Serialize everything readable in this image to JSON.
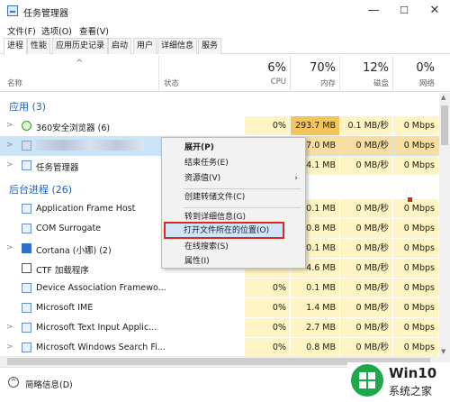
{
  "window": {
    "title": "任务管理器",
    "min": "—",
    "max": "☐",
    "close": "✕"
  },
  "menu": [
    "文件(F)",
    "选项(O)",
    "查看(V)"
  ],
  "tabs": [
    "进程",
    "性能",
    "应用历史记录",
    "启动",
    "用户",
    "详细信息",
    "服务"
  ],
  "columns": {
    "name": "名称",
    "status": "状态",
    "cpu_pct": "6%",
    "cpu": "CPU",
    "mem_pct": "70%",
    "mem": "内存",
    "disk_pct": "12%",
    "disk": "磁盘",
    "net_pct": "0%",
    "net": "网络"
  },
  "groups": {
    "apps": "应用 (3)",
    "background": "后台进程 (26)"
  },
  "rows": [
    {
      "name": "360安全浏览器 (6)",
      "cpu": "0%",
      "mem": "293.7 MB",
      "disk": "0.1 MB/秒",
      "net": "0 Mbps"
    },
    {
      "name": "",
      "cpu": "",
      "mem": "7.0 MB",
      "disk": "0 MB/秒",
      "net": "0 Mbps"
    },
    {
      "name": "任务管理器",
      "cpu": "",
      "mem": "4.1 MB",
      "disk": "0 MB/秒",
      "net": "0 Mbps"
    },
    {
      "name": "Application Frame Host",
      "cpu": "",
      "mem": "0.1 MB",
      "disk": "0 MB/秒",
      "net": "0 Mbps"
    },
    {
      "name": "COM Surrogate",
      "cpu": "",
      "mem": "0.8 MB",
      "disk": "0 MB/秒",
      "net": "0 Mbps"
    },
    {
      "name": "Cortana (小娜) (2)",
      "cpu": "",
      "mem": "0.1 MB",
      "disk": "0 MB/秒",
      "net": "0 Mbps"
    },
    {
      "name": "CTF 加载程序",
      "cpu": "",
      "mem": "4.6 MB",
      "disk": "0 MB/秒",
      "net": "0 Mbps"
    },
    {
      "name": "Device Association Framewo...",
      "cpu": "0%",
      "mem": "0.1 MB",
      "disk": "0 MB/秒",
      "net": "0 Mbps"
    },
    {
      "name": "Microsoft IME",
      "cpu": "0%",
      "mem": "1.4 MB",
      "disk": "0 MB/秒",
      "net": "0 Mbps"
    },
    {
      "name": "Microsoft Text Input Applic...",
      "cpu": "0%",
      "mem": "2.7 MB",
      "disk": "0 MB/秒",
      "net": "0 Mbps"
    },
    {
      "name": "Microsoft Windows Search Fi...",
      "cpu": "0%",
      "mem": "0.8 MB",
      "disk": "0 MB/秒",
      "net": "0 Mbps"
    }
  ],
  "context_menu": {
    "expand": "展开(P)",
    "end_task": "结束任务(E)",
    "resource_values": "资源值(V)",
    "create_dump": "创建转储文件(C)",
    "goto_details": "转到详细信息(G)",
    "open_location": "打开文件所在的位置(O)",
    "search_online": "在线搜索(S)",
    "properties": "属性(I)"
  },
  "footer": {
    "brief": "简略信息(D)"
  },
  "watermark": {
    "line1": "Win10",
    "line2": "系统之家"
  },
  "colors": {
    "highlight_row": "#f8dea0",
    "cell": "#fff4c4",
    "group": "#1f5fb0",
    "red_box": "#e0271c"
  }
}
